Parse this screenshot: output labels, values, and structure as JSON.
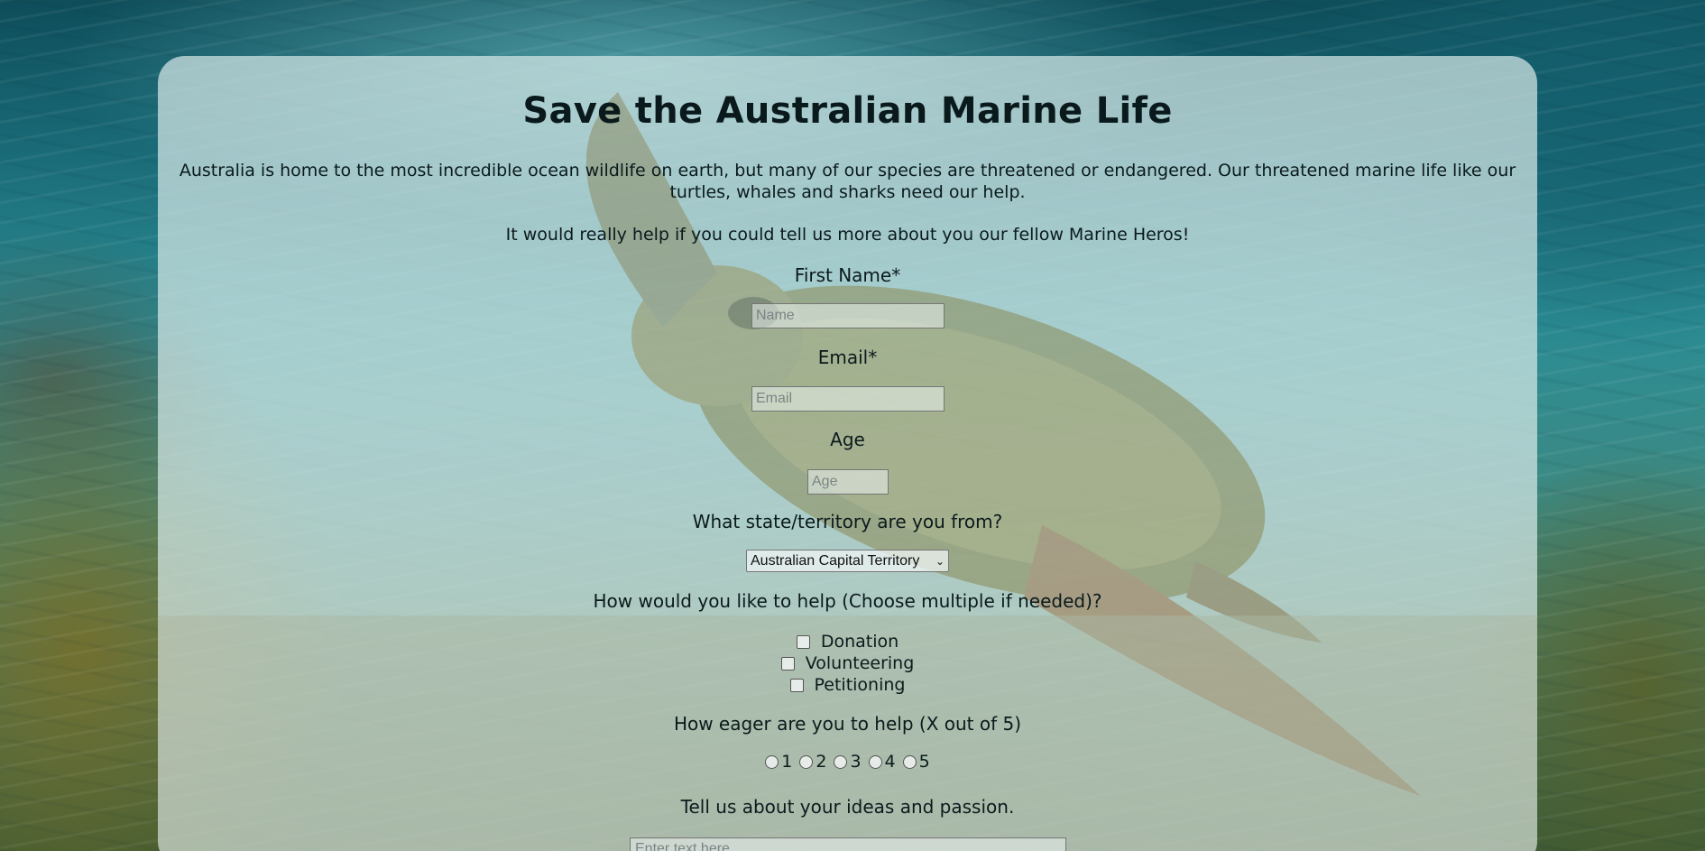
{
  "page": {
    "title": "Save the Australian Marine Life",
    "intro": "Australia is home to the most incredible ocean wildlife on earth, but many of our species are threatened or endangered. Our threatened marine life like our turtles, whales and sharks need our help.",
    "ask": "It would really help if you could tell us more about you our fellow Marine Heros!"
  },
  "form": {
    "first_name": {
      "label": "First Name*",
      "placeholder": "Name"
    },
    "email": {
      "label": "Email*",
      "placeholder": "Email"
    },
    "age": {
      "label": "Age",
      "placeholder": "Age"
    },
    "state": {
      "label": "What state/territory are you from?",
      "selected": "Australian Capital Territory"
    },
    "help": {
      "label": "How would you like to help (Choose multiple if needed)?",
      "options": [
        "Donation",
        "Volunteering",
        "Petitioning"
      ]
    },
    "eagerness": {
      "label": "How eager are you to help (X out of 5)",
      "options": [
        "1",
        "2",
        "3",
        "4",
        "5"
      ]
    },
    "ideas": {
      "label": "Tell us about your ideas and passion.",
      "placeholder": "Enter text here..."
    }
  },
  "icons": {
    "select_arrow": "chevron-down-icon"
  },
  "colors": {
    "card_overlay": "#d6e8e6",
    "ocean_deep": "#0e4d5a",
    "text": "#0a1a1c"
  }
}
